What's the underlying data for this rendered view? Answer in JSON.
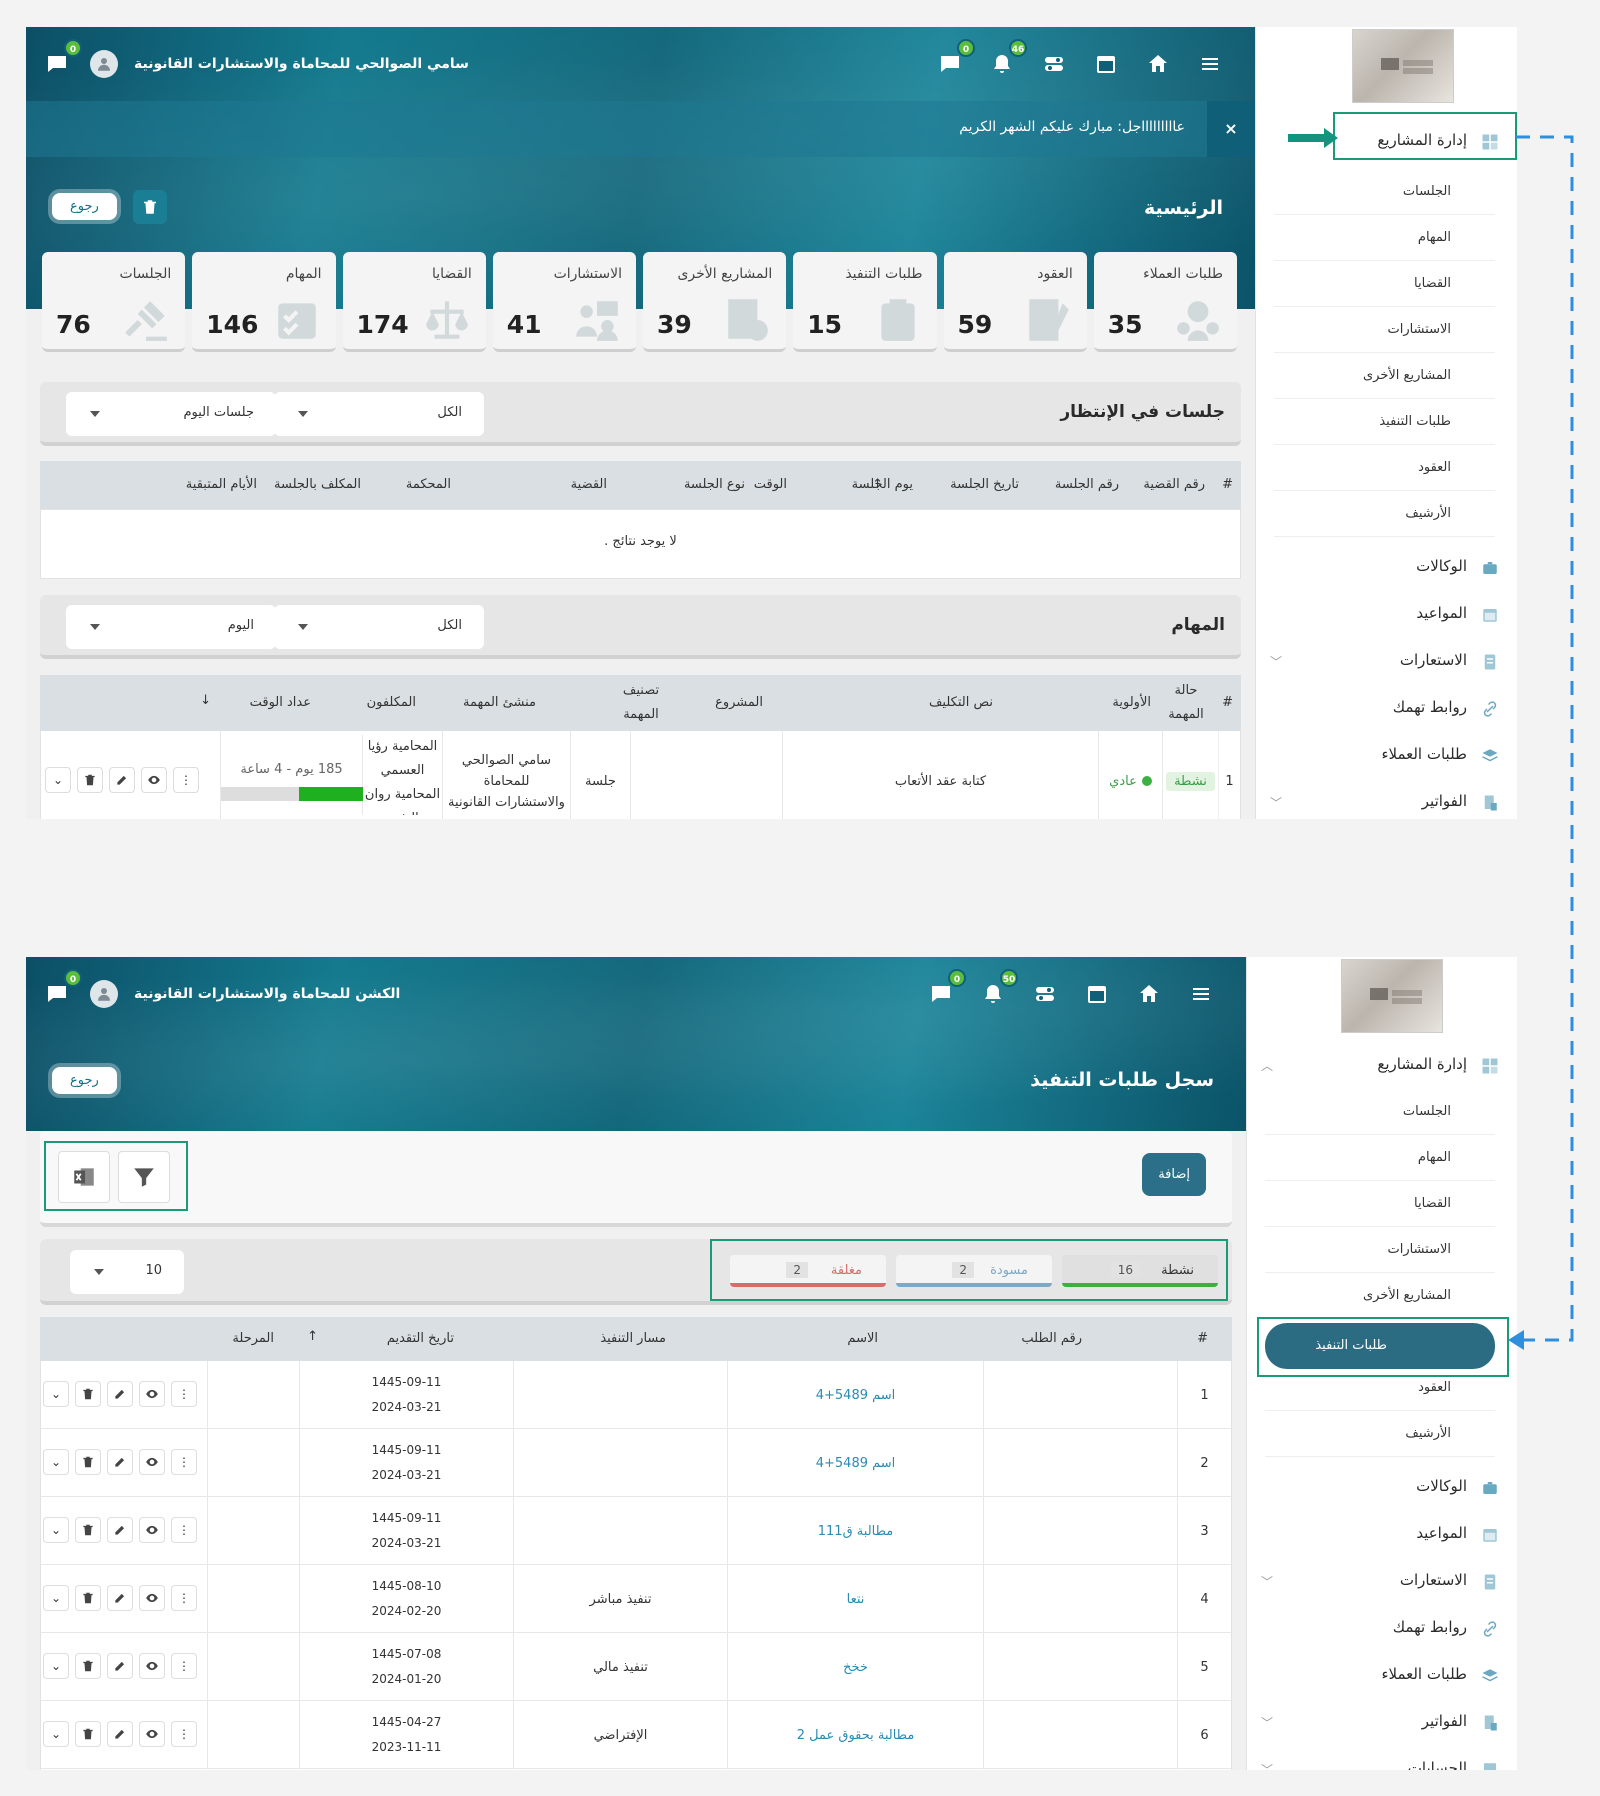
{
  "screen1": {
    "user_name": "سامي الصوالحي للمحاماة والاستشارات القانونية",
    "badges": {
      "chat_left": "0",
      "messages": "0",
      "bell": "46"
    },
    "date_icon": "31",
    "announcement": "عاااااااااجل: مبارك عليكم الشهر الكريم",
    "close": "×",
    "title": "الرئيسية",
    "back": "رجوع",
    "cards": [
      {
        "label": "الجلسات",
        "value": "76",
        "icon": "gavel-icon"
      },
      {
        "label": "المهام",
        "value": "146",
        "icon": "checklist-icon"
      },
      {
        "label": "القضايا",
        "value": "174",
        "icon": "scales-icon"
      },
      {
        "label": "الاستشارات",
        "value": "41",
        "icon": "consult-icon"
      },
      {
        "label": "المشاريع الأخرى",
        "value": "39",
        "icon": "project-icon"
      },
      {
        "label": "طلبات التنفيذ",
        "value": "15",
        "icon": "clipboard-icon"
      },
      {
        "label": "العقود",
        "value": "59",
        "icon": "contract-icon"
      },
      {
        "label": "طلبات العملاء",
        "value": "35",
        "icon": "clients-icon"
      }
    ],
    "sessions": {
      "title": "جلسات في الإنتظار",
      "filter_all": "الكل",
      "filter_day": "جلسات اليوم",
      "columns": [
        "#",
        "رقم القضية",
        "رقم الجلسة",
        "تاريخ الجلسة",
        "يوم الجلسة",
        "الوقت",
        "نوع الجلسة",
        "القضية",
        "المحكمة",
        "المكلف بالجلسة",
        "الأيام المتبقية"
      ],
      "empty": "لا يوجد نتائج ."
    },
    "tasks": {
      "title": "المهام",
      "filter_all": "الكل",
      "filter_day": "اليوم",
      "columns": {
        "num": "#",
        "status": "حالة المهمة",
        "priority": "الأولوية",
        "text": "نص التكليف",
        "project": "المشروع",
        "category": "تصنيف المهمة",
        "creator": "منشئ المهمة",
        "assignees": "المكلفون",
        "timer": "عداد الوقت"
      },
      "row": {
        "num": "1",
        "status": "نشطة",
        "priority": "عادي",
        "text": "كتابة عقد الأتعاب",
        "project": "",
        "category": "جلسة",
        "creator": "سامي الصوالحي للمحاماة والاستشارات القانونية",
        "assignees": "المحامية رؤيا العسمي المحامية روان الش..",
        "timer": "185 يوم - 4 ساعة",
        "timer_progress": 0.45
      }
    },
    "sidebar": {
      "parent": "إدارة المشاريع",
      "subs": [
        "الجلسات",
        "المهام",
        "القضايا",
        "الاستشارات",
        "المشاريع الأخرى",
        "طلبات التنفيذ",
        "العقود",
        "الأرشيف"
      ],
      "parents": [
        "الوكالات",
        "المواعيد",
        "الاستعارات",
        "روابط تهمك",
        "طلبات العملاء",
        "الفواتير"
      ]
    }
  },
  "screen2": {
    "user_name": "الكشن للمحاماة والاستشارات القانونية",
    "badges": {
      "chat_left": "0",
      "messages": "0",
      "bell": "50"
    },
    "date_icon": "31",
    "title": "سجل طلبات التنفيذ",
    "back": "رجوع",
    "add": "إضافة",
    "tabs": [
      {
        "label": "نشطة",
        "count": "16",
        "color": "#3cb043"
      },
      {
        "label": "مسودة",
        "count": "2",
        "color": "#7fa8c4"
      },
      {
        "label": "مغلقة",
        "count": "2",
        "color": "#d66c6c"
      }
    ],
    "page_size": "10",
    "columns": {
      "num": "#",
      "req": "رقم الطلب",
      "name": "الاسم",
      "path": "مسار التنفيذ",
      "date": "تاريخ التقديم",
      "stage": "المرحلة"
    },
    "rows": [
      {
        "num": "1",
        "name": "اسم 5489+4",
        "path": "",
        "hijri": "1445-09-11",
        "greg": "2024-03-21"
      },
      {
        "num": "2",
        "name": "اسم 5489+4",
        "path": "",
        "hijri": "1445-09-11",
        "greg": "2024-03-21"
      },
      {
        "num": "3",
        "name": "مطالبة ق111",
        "path": "",
        "hijri": "1445-09-11",
        "greg": "2024-03-21"
      },
      {
        "num": "4",
        "name": "نتعا",
        "path": "تنفيذ مباشر",
        "hijri": "1445-08-10",
        "greg": "2024-02-20"
      },
      {
        "num": "5",
        "name": "خخخ",
        "path": "تنفيذ مالي",
        "hijri": "1445-07-08",
        "greg": "2024-01-20"
      },
      {
        "num": "6",
        "name": "مطالبة بحقوق عمل 2",
        "path": "الإفتراضي",
        "hijri": "1445-04-27",
        "greg": "2023-11-11"
      }
    ],
    "sidebar": {
      "parent": "إدارة المشاريع",
      "subs": [
        "الجلسات",
        "المهام",
        "القضايا",
        "الاستشارات",
        "المشاريع الأخرى",
        "طلبات التنفيذ",
        "العقود",
        "الأرشيف"
      ],
      "parents": [
        "الوكالات",
        "المواعيد",
        "الاستعارات",
        "روابط تهمك",
        "طلبات العملاء",
        "الفواتير",
        "الحسابات"
      ]
    }
  },
  "colors": {
    "accent": "#1a9a77",
    "brand": "#2c6c82",
    "link": "#2a8bb3",
    "connector": "#2f8fdc"
  }
}
